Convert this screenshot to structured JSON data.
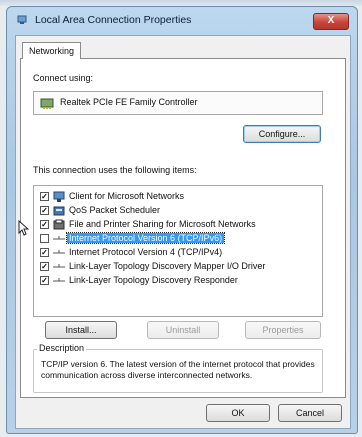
{
  "window": {
    "title": "Local Area Connection Properties",
    "close_label": "X"
  },
  "tabs": [
    {
      "label": "Networking"
    }
  ],
  "connect_using": {
    "label": "Connect using:",
    "adapter_name": "Realtek PCIe FE Family Controller",
    "configure_label": "Configure..."
  },
  "items_section": {
    "label": "This connection uses the following items:",
    "items": [
      {
        "label": "Client for Microsoft Networks",
        "checked": true,
        "icon": "network-client-icon"
      },
      {
        "label": "QoS Packet Scheduler",
        "checked": true,
        "icon": "qos-scheduler-icon"
      },
      {
        "label": "File and Printer Sharing for Microsoft Networks",
        "checked": true,
        "icon": "file-printer-sharing-icon"
      },
      {
        "label": "Internet Protocol Version 6 (TCP/IPv6)",
        "checked": false,
        "selected": true,
        "icon": "protocol-icon"
      },
      {
        "label": "Internet Protocol Version 4 (TCP/IPv4)",
        "checked": true,
        "icon": "protocol-icon"
      },
      {
        "label": "Link-Layer Topology Discovery Mapper I/O Driver",
        "checked": true,
        "icon": "protocol-icon"
      },
      {
        "label": "Link-Layer Topology Discovery Responder",
        "checked": true,
        "icon": "protocol-icon"
      }
    ]
  },
  "actions": {
    "install_label": "Install...",
    "uninstall_label": "Uninstall",
    "properties_label": "Properties"
  },
  "description": {
    "legend": "Description",
    "text": "TCP/IP version 6. The latest version of the internet protocol that provides communication across diverse interconnected networks."
  },
  "footer": {
    "ok_label": "OK",
    "cancel_label": "Cancel"
  },
  "colors": {
    "title_bar": "#a9c8e3",
    "selection": "#3399ff",
    "close_button": "#c7453a"
  }
}
